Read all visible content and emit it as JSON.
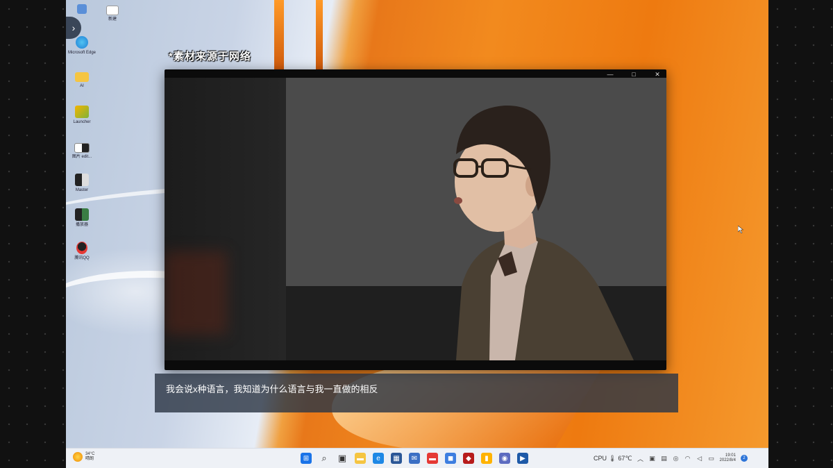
{
  "watermark": "*素材来源于网络",
  "desktop": {
    "icons": [
      {
        "label": "",
        "icon": "recycle-bin-icon",
        "color": "#5a8fd8"
      },
      {
        "label": "新建",
        "icon": "document-icon",
        "color": "#ffffff"
      },
      {
        "label": "Microsoft Edge",
        "icon": "edge-icon",
        "color": "#1e7fd6"
      },
      {
        "label": "AI",
        "icon": "folder-icon",
        "color": "#f5c542"
      },
      {
        "label": "Launcher",
        "icon": "game-icon",
        "color": "#7fb33a"
      },
      {
        "label": "图片 edit...",
        "icon": "image-icon",
        "color": "#ffffff"
      },
      {
        "label": "Master",
        "icon": "app-icon",
        "color": "#222222"
      },
      {
        "label": "播放器",
        "icon": "app-icon",
        "color": "#3a7d44"
      },
      {
        "label": "腾讯QQ",
        "icon": "qq-icon",
        "color": "#e53935"
      }
    ]
  },
  "player": {
    "controls": {
      "minimize": "—",
      "maximize": "□",
      "close": "✕"
    }
  },
  "subtitle": "我会说x种语言，我知道为什么语言与我一直做的相反",
  "taskbar": {
    "weather_temp": "34°C",
    "weather_desc": "晴朗",
    "apps": [
      {
        "name": "start",
        "icon": "windows-icon",
        "color": "#1a73e8",
        "glyph": "⊞"
      },
      {
        "name": "search",
        "icon": "search-icon",
        "color": "#333333",
        "glyph": "⌕"
      },
      {
        "name": "taskview",
        "icon": "task-view-icon",
        "color": "#333333",
        "glyph": "▣"
      },
      {
        "name": "explorer",
        "icon": "folder-icon",
        "color": "#f5c542",
        "glyph": "▬"
      },
      {
        "name": "edge",
        "icon": "edge-icon",
        "color": "#1e88e5",
        "glyph": "e"
      },
      {
        "name": "store",
        "icon": "store-icon",
        "color": "#2b5797",
        "glyph": "▦"
      },
      {
        "name": "mail",
        "icon": "mail-icon",
        "color": "#3b6fc4",
        "glyph": "✉"
      },
      {
        "name": "app-red",
        "icon": "app-icon",
        "color": "#e53935",
        "glyph": "▬"
      },
      {
        "name": "app-blue",
        "icon": "app-icon",
        "color": "#3d7ee0",
        "glyph": "◼"
      },
      {
        "name": "app-dark",
        "icon": "app-icon",
        "color": "#b71c1c",
        "glyph": "◆"
      },
      {
        "name": "app-orange",
        "icon": "app-icon",
        "color": "#ffb300",
        "glyph": "▮"
      },
      {
        "name": "app-globe",
        "icon": "globe-icon",
        "color": "#5c6bc0",
        "glyph": "◉"
      },
      {
        "name": "player",
        "icon": "video-player-icon",
        "color": "#1e5aa8",
        "glyph": "▶"
      }
    ],
    "cpu_text": "CPU 🌡 67℃",
    "clock_time": "19:01",
    "clock_date": "2022/8/4",
    "notification_count": "2"
  }
}
